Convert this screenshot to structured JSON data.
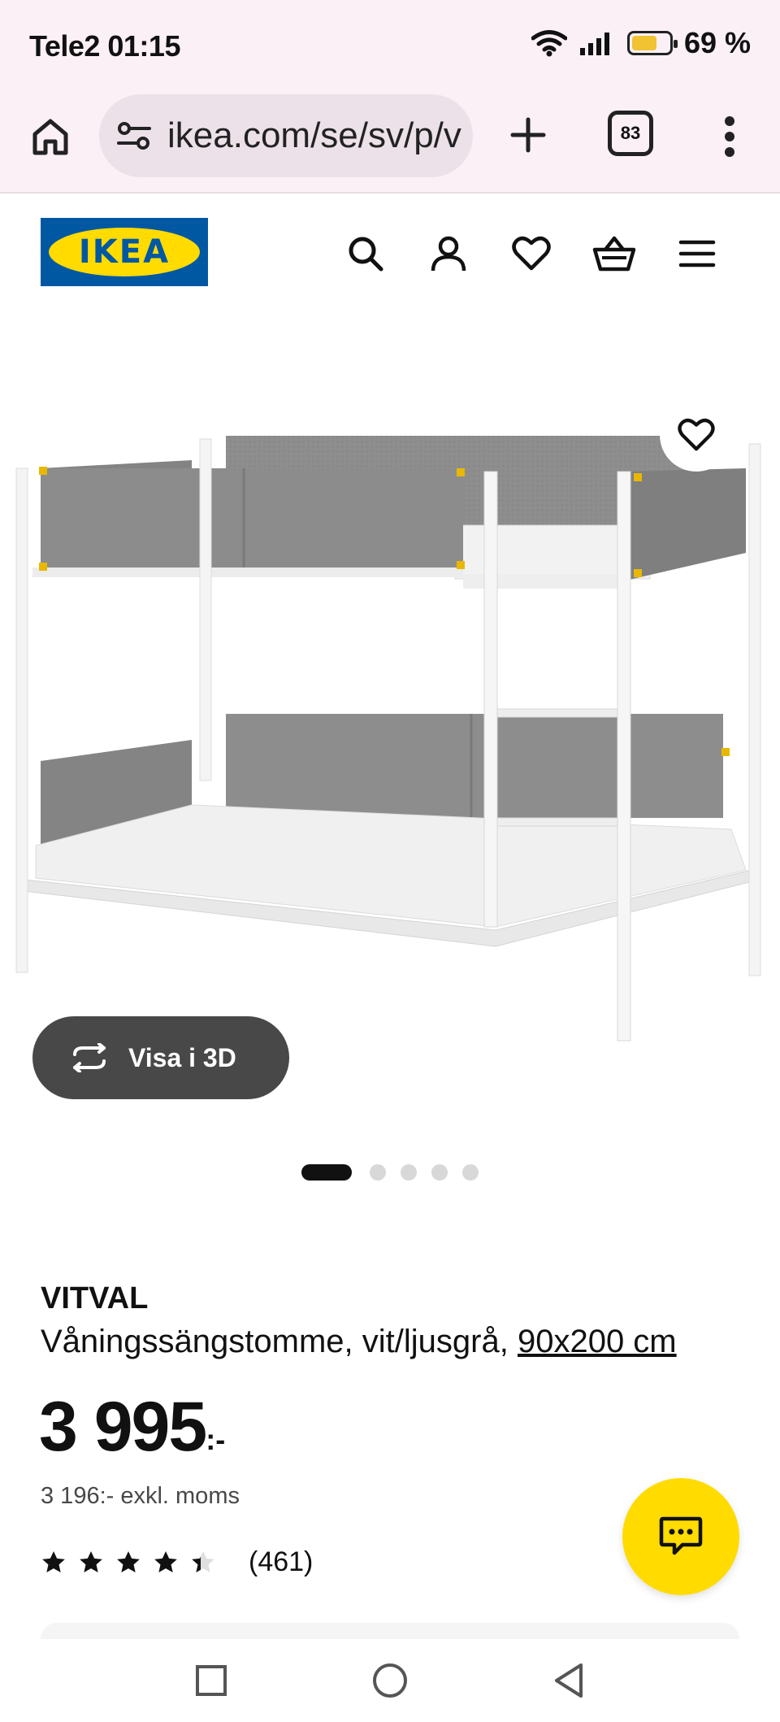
{
  "status_bar": {
    "carrier_time": "Tele2 01:15",
    "battery_percent": "69 %",
    "battery_level": 0.69
  },
  "browser": {
    "url": "ikea.com/se/sv/p/v",
    "tab_count": "83"
  },
  "product": {
    "brand": "VITVAL",
    "description": "Våningssängstomme, vit/ljusgrå,",
    "size": "90x200 cm",
    "price": "3 995",
    "price_suffix": ":-",
    "price_ex_vat": "3 196:- exkl. moms",
    "rating_count": "(461)",
    "rating_value": 4.4
  },
  "view3d": {
    "label": "Visa i 3D"
  },
  "gallery": {
    "image_count": 5,
    "active_index": 0
  },
  "colors": {
    "ikea_blue": "#0058a3",
    "ikea_yellow": "#ffdb00",
    "chrome_bg": "#fbf0f6"
  }
}
